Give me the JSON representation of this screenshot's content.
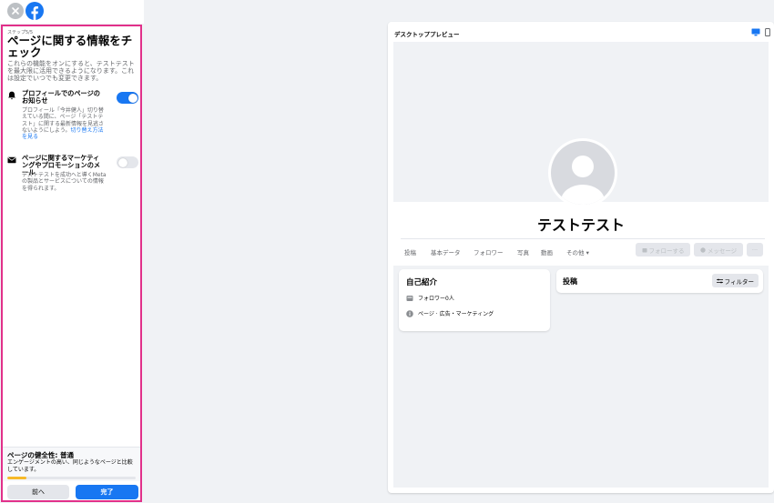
{
  "sidebar": {
    "step_label": "ステップ5/5",
    "title": "ページに関する情報をチェック",
    "intro": "これらの機能をオンにすると、テストテストを最大限に活用できるようになります。これは設定でいつでも変更できます。",
    "settings": [
      {
        "title": "プロフィールでのページのお知らせ",
        "desc": "プロフィール「今井健人」切り替えている間に、ページ「テストテスト」に関する最新情報を見逃さないようにしよう。",
        "link": "切り替え方法を見る",
        "enabled": true
      },
      {
        "title": "ページに関するマーケティングやプロモーションのメール",
        "desc": "テストテストを成功へと導くMetaの製品とサービスについての情報を得られます。",
        "link": "",
        "enabled": false
      }
    ],
    "health": {
      "title": "ページの健全性: 普通",
      "text": "エンゲージメントの高い、同じようなページと比較しています。",
      "progress": 0.15,
      "color": "#f7b928"
    },
    "back_label": "前へ",
    "done_label": "完了"
  },
  "preview": {
    "label": "デスクトッププレビュー",
    "page_name": "テストテスト",
    "tabs": [
      "投稿",
      "基本データ",
      "フォロワー",
      "写真",
      "動画",
      "その他 ▾"
    ],
    "follow_label": "フォローする",
    "message_label": "メッセージ",
    "more_label": "···",
    "intro_title": "自己紹介",
    "followers_text": "フォロワー0人",
    "category_text": "ページ · 広告・マーケティング",
    "posts_title": "投稿",
    "filter_label": "フィルター"
  },
  "colors": {
    "accent": "#1877f2",
    "sidebar_border": "#e1308a"
  },
  "icons": [
    "close-icon",
    "facebook-logo",
    "bell-icon",
    "mail-icon",
    "desktop-icon",
    "mobile-icon",
    "follow-icon",
    "messenger-icon",
    "followers-icon",
    "info-icon",
    "filter-icon"
  ]
}
